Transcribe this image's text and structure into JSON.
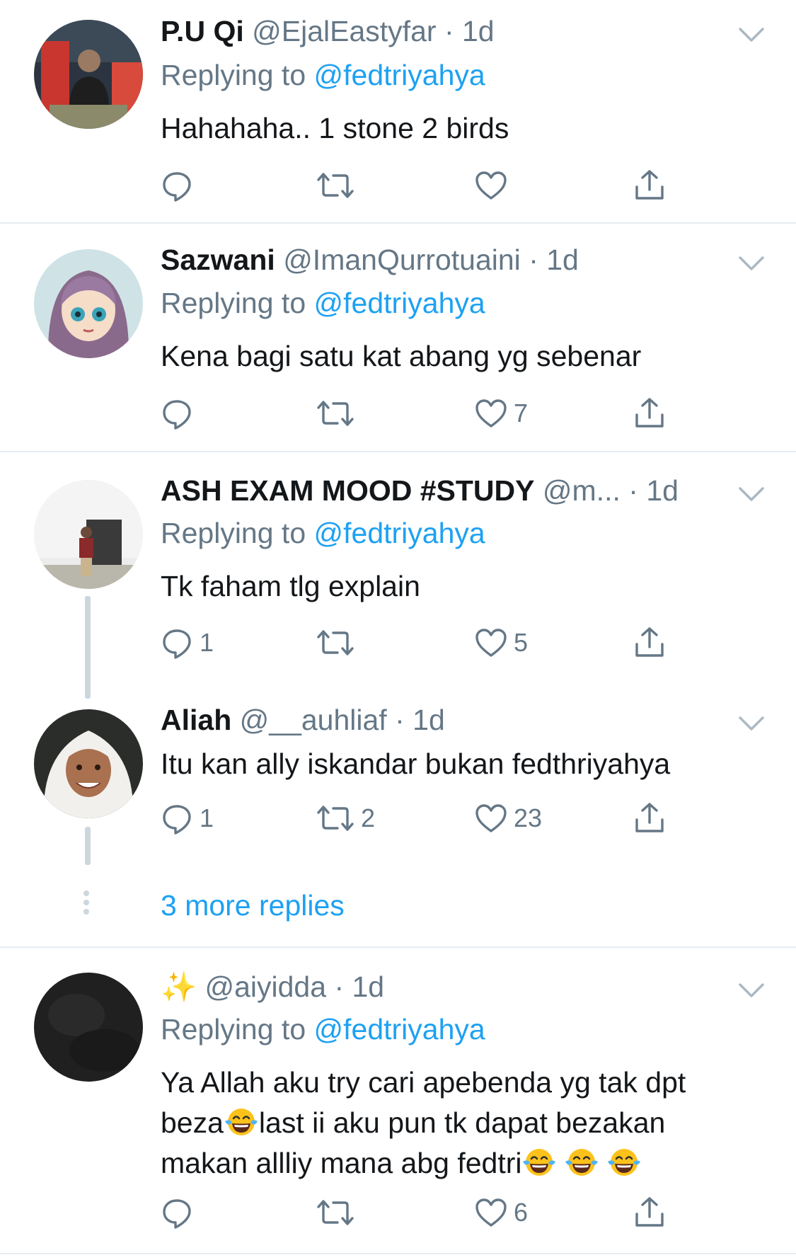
{
  "tweets": [
    {
      "name": "P.U Qi",
      "handle": "@EjalEastyfar",
      "time": "1d",
      "replying_prefix": "Replying to ",
      "replying_to": "@fedtriyahya",
      "text": "Hahahaha.. 1 stone 2 birds",
      "replies": "",
      "retweets": "",
      "likes": ""
    },
    {
      "name": "Sazwani",
      "handle": "@ImanQurrotuaini",
      "time": "1d",
      "replying_prefix": "Replying to ",
      "replying_to": "@fedtriyahya",
      "text": "Kena bagi satu kat abang yg sebenar",
      "replies": "",
      "retweets": "",
      "likes": "7"
    },
    {
      "name": "ASH EXAM MOOD #STUDY",
      "handle": "@m...",
      "time": "1d",
      "replying_prefix": "Replying to ",
      "replying_to": "@fedtriyahya",
      "text": "Tk faham tlg explain",
      "replies": "1",
      "retweets": "",
      "likes": "5"
    },
    {
      "name": "Aliah",
      "handle": "@__auhliaf",
      "time": "1d",
      "text": "Itu kan ally iskandar bukan fedthriyahya",
      "replies": "1",
      "retweets": "2",
      "likes": "23"
    },
    {
      "name": "✨",
      "handle": "@aiyidda",
      "time": "1d",
      "replying_prefix": "Replying to ",
      "replying_to": "@fedtriyahya",
      "text_line1": "Ya Allah aku try cari apebenda yg tak dpt",
      "text_line2_a": "beza",
      "text_line2_b": "last ii aku pun tk dapat bezakan",
      "text_line3": "makan allliy mana abg fedtri",
      "replies": "",
      "retweets": "",
      "likes": "6"
    }
  ],
  "more_replies": "3 more replies",
  "dot_separator": "·",
  "icons": {
    "reply": "reply-icon",
    "retweet": "retweet-icon",
    "like": "heart-icon",
    "share": "share-icon",
    "caret": "chevron-down-icon",
    "emoji": "face-with-tears-of-joy-emoji"
  },
  "colors": {
    "link": "#1da1f2",
    "secondary": "#657786",
    "separator": "#e6ecf0",
    "thread_line": "#ccd6dd"
  }
}
